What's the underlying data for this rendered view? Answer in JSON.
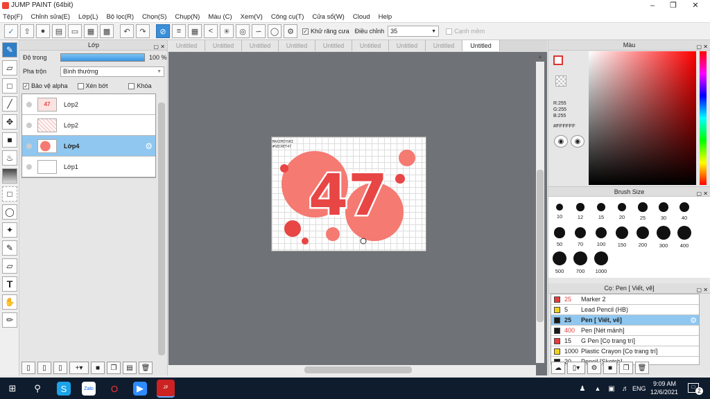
{
  "window": {
    "title": "JUMP PAINT (64bit)"
  },
  "menu": [
    "Tệp(F)",
    "Chỉnh sửa(E)",
    "Lớp(L)",
    "Bộ lọc(R)",
    "Chọn(S)",
    "Chụp(N)",
    "Màu (C)",
    "Xem(V)",
    "Công cụ(T)",
    "Cửa sổ(W)",
    "Cloud",
    "Help"
  ],
  "toolbar": {
    "antialias_label": "Khử răng cưa",
    "adjust_label": "Điều chỉnh",
    "adjust_value": "35",
    "smooth_label": "Cạnh mềm"
  },
  "layer_panel": {
    "title": "Lớp",
    "opacity_label": "Độ trong",
    "opacity_value": "100 %",
    "opacity_fraction": 1.0,
    "blend_label": "Pha trộn",
    "blend_value": "Bình thường",
    "protect_alpha": "Bảo vệ alpha",
    "clip": "Xén bớt",
    "lock": "Khóa",
    "layers": [
      {
        "name": "Lớp2"
      },
      {
        "name": "Lớp2"
      },
      {
        "name": "Lớp4",
        "selected": true
      },
      {
        "name": "Lớp1"
      }
    ]
  },
  "tabs": [
    "Untitled",
    "Untitled",
    "Untitled",
    "Untitled",
    "Untitled",
    "Untitled",
    "Untitled",
    "Untitled",
    "Untitled"
  ],
  "artwork": {
    "top_text_1": "MAXIMIYUKI",
    "top_text_2": "#SECRET47",
    "number": "47"
  },
  "color_panel": {
    "title": "Màu",
    "r": "R:255",
    "g": "G:255",
    "b": "B:255",
    "hex": "#FFFFFF"
  },
  "brush_panel": {
    "title": "Brush Size",
    "sizes": [
      "10",
      "12",
      "15",
      "20",
      "25",
      "30",
      "40",
      "50",
      "70",
      "100",
      "150",
      "200",
      "300",
      "400",
      "500",
      "700",
      "1000"
    ]
  },
  "pen_panel": {
    "title": "Cọ: Pen [ Viết, vẽ]",
    "items": [
      {
        "size": "25",
        "name": "Marker 2",
        "color": "#e83c3c"
      },
      {
        "size": "5",
        "name": "Lead Pencil (HB)",
        "color": "#f0d21a"
      },
      {
        "size": "25",
        "name": "Pen [ Viết, vẽ]",
        "color": "#1a1a1a",
        "selected": true
      },
      {
        "size": "400",
        "name": "Pen [Nét mảnh]",
        "color": "#1a1a1a"
      },
      {
        "size": "15",
        "name": "G Pen [Cọ trang trí]",
        "color": "#e83c3c"
      },
      {
        "size": "1000",
        "name": "Plastic Crayon [Cọ trang trí]",
        "color": "#f0d21a"
      },
      {
        "size": "20",
        "name": "Pencil [Sketch]",
        "color": "#1a1a1a"
      }
    ]
  },
  "taskbar": {
    "lang": "ENG",
    "time": "9:09 AM",
    "date": "12/6/2021",
    "notif": "2"
  },
  "colors": {
    "accent": "#3a8fd8",
    "selection": "#8fc7f0",
    "art_coral": "#f47a72",
    "art_red": "#e84545"
  }
}
